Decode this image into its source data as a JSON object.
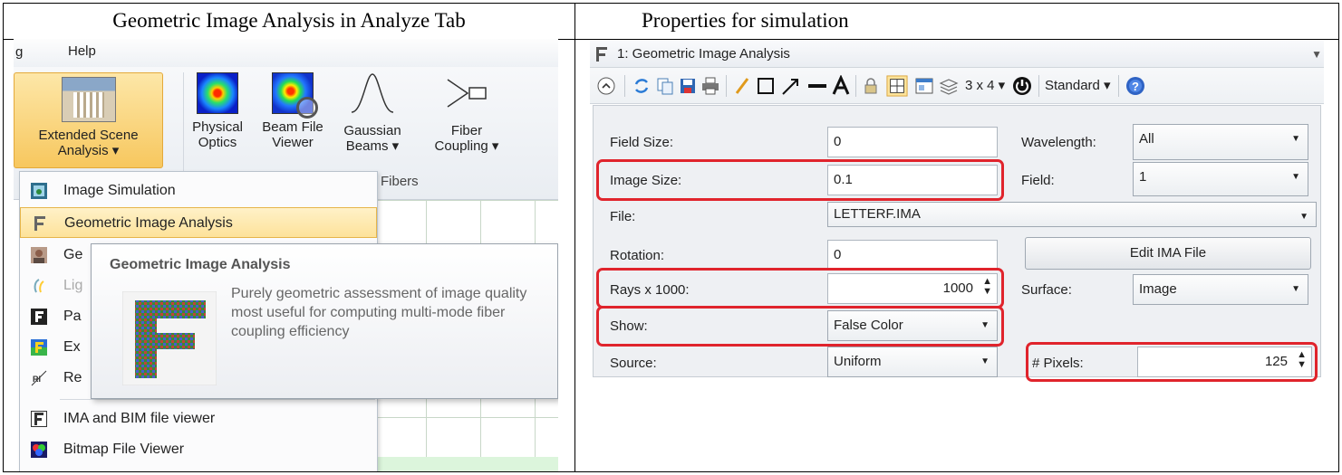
{
  "headers": {
    "left": "Geometric Image Analysis in Analyze Tab",
    "right": "Properties for simulation"
  },
  "left_panel": {
    "menubar": {
      "fragment": "g",
      "help": "Help"
    },
    "ribbon": {
      "buttons": [
        {
          "line1": "Extended Scene",
          "line2": "Analysis ▾"
        },
        {
          "line1": "Physical",
          "line2": "Optics"
        },
        {
          "line1": "Beam File",
          "line2": "Viewer"
        },
        {
          "line1": "Gaussian",
          "line2": "Beams ▾"
        },
        {
          "line1": "Fiber",
          "line2": "Coupling ▾"
        }
      ],
      "group_label": "Fibers"
    },
    "menu": {
      "items": [
        {
          "label": "Image Simulation",
          "icon": "image-simulation-icon"
        },
        {
          "label": "Geometric Image Analysis",
          "icon": "letter-f-icon"
        },
        {
          "label": "Ge",
          "icon": "portrait-icon"
        },
        {
          "label": "Lig",
          "icon": "light-icon"
        },
        {
          "label": "Pa",
          "icon": "f-dark-icon"
        },
        {
          "label": "Ex",
          "icon": "f-color-icon"
        },
        {
          "label": "Re",
          "icon": "ri-icon",
          "icon_text": "RI"
        },
        {
          "label": "IMA and BIM file viewer",
          "icon": "letter-f-icon"
        },
        {
          "label": "Bitmap File Viewer",
          "icon": "bitmap-icon"
        }
      ]
    },
    "tooltip": {
      "title": "Geometric Image Analysis",
      "description": "Purely geometric assessment of image quality most useful for computing multi-mode fiber coupling efficiency"
    }
  },
  "right_panel": {
    "title": "1: Geometric Image Analysis",
    "toolbar": {
      "grid_label": "3 x 4 ▾",
      "standard_label": "Standard ▾"
    },
    "fields": {
      "field_size": {
        "label": "Field Size:",
        "value": "0"
      },
      "image_size": {
        "label": "Image Size:",
        "value": "0.1"
      },
      "file": {
        "label": "File:",
        "value": "LETTERF.IMA"
      },
      "rotation": {
        "label": "Rotation:",
        "value": "0"
      },
      "rays": {
        "label": "Rays x 1000:",
        "value": "1000"
      },
      "show": {
        "label": "Show:",
        "value": "False Color"
      },
      "source": {
        "label": "Source:",
        "value": "Uniform"
      },
      "wavelength": {
        "label": "Wavelength:",
        "value": "All"
      },
      "field": {
        "label": "Field:",
        "value": "1"
      },
      "edit_ima": {
        "label": "Edit IMA File"
      },
      "surface": {
        "label": "Surface:",
        "value": "Image"
      },
      "pixels": {
        "label": "# Pixels:",
        "value": "125"
      }
    },
    "highlight_color": "#e0242c"
  }
}
